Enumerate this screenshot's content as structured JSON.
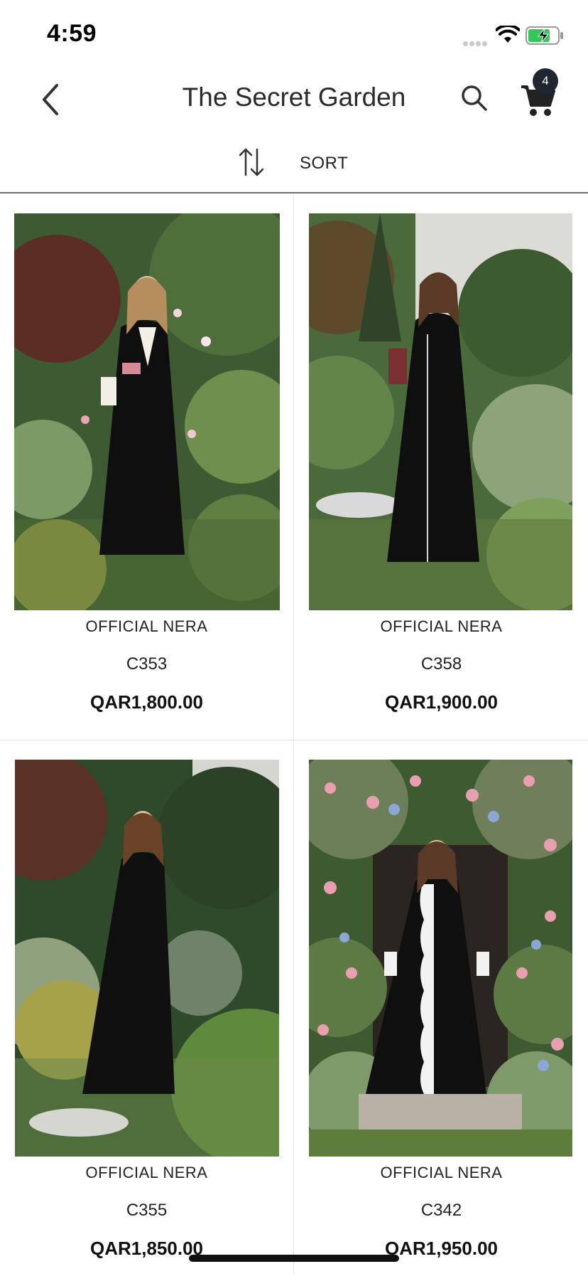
{
  "status_bar": {
    "time": "4:59"
  },
  "nav": {
    "title": "The Secret Garden",
    "cart_count": "4"
  },
  "sort": {
    "label": "SORT"
  },
  "products": [
    {
      "brand": "OFFICIAL NERA",
      "sku": "C353",
      "price": "QAR1,800.00"
    },
    {
      "brand": "OFFICIAL NERA",
      "sku": "C358",
      "price": "QAR1,900.00"
    },
    {
      "brand": "OFFICIAL NERA",
      "sku": "C355",
      "price": "QAR1,850.00"
    },
    {
      "brand": "OFFICIAL NERA",
      "sku": "C342",
      "price": "QAR1,950.00"
    }
  ],
  "colors": {
    "accent": "#1e2630",
    "foliage_dark": "#2f4a2a",
    "foliage_light": "#6f8f4e",
    "dress": "#111111"
  }
}
